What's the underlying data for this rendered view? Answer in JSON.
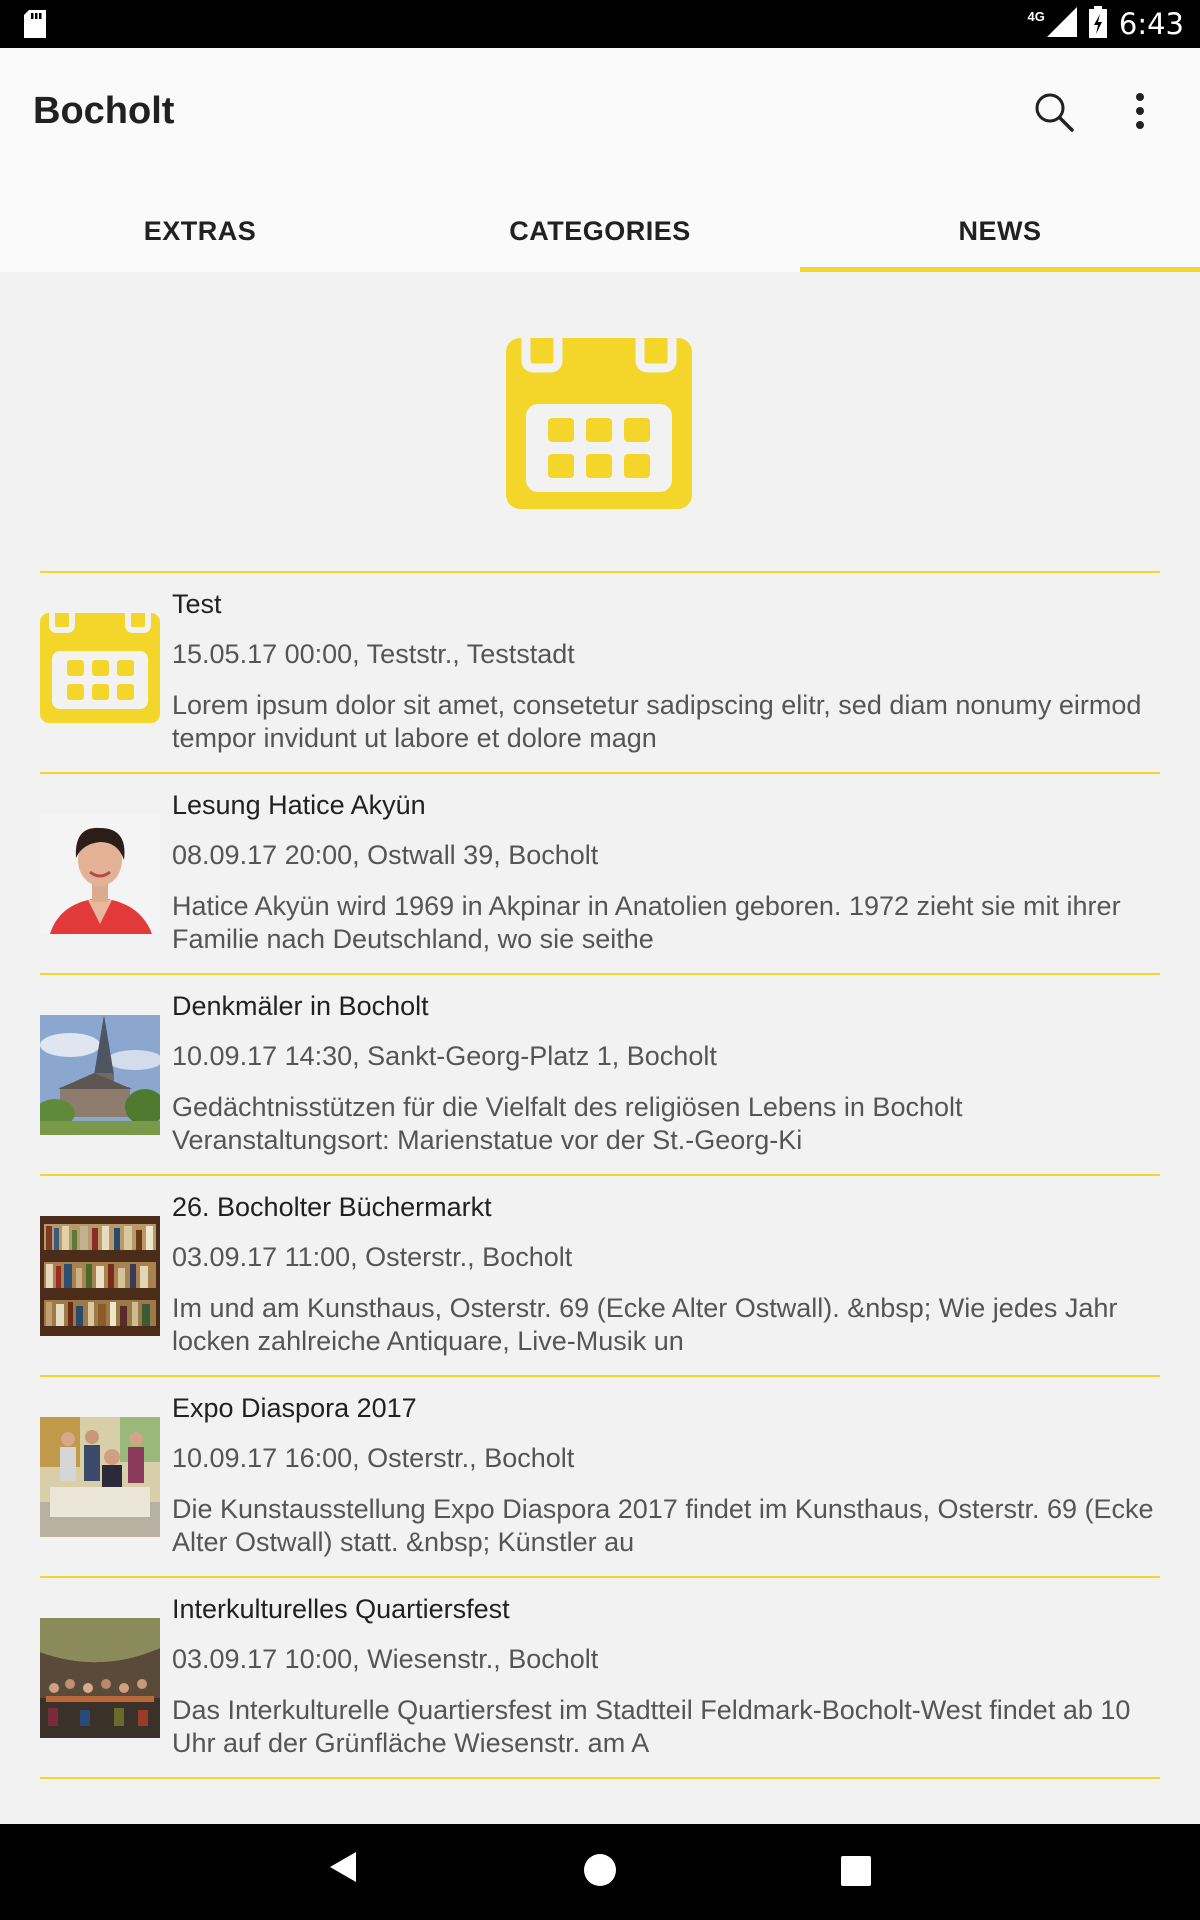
{
  "status_bar": {
    "time": "6:43",
    "network": "4G",
    "icons": [
      "sd-card-icon",
      "signal-icon",
      "battery-charging-icon"
    ]
  },
  "app_bar": {
    "title": "Bocholt",
    "actions": [
      "search-icon",
      "overflow-menu-icon"
    ]
  },
  "tabs": [
    {
      "label": "EXTRAS"
    },
    {
      "label": "CATEGORIES"
    },
    {
      "label": "NEWS"
    }
  ],
  "active_tab": "NEWS",
  "accent_color": "#f4d62a",
  "hero_icon": "calendar-icon",
  "events": [
    {
      "title": "Test",
      "meta": "15.05.17 00:00, Teststr., Teststadt",
      "desc": "Lorem ipsum dolor sit amet, consetetur sadipscing elitr, sed diam nonumy eirmod tempor invidunt ut labore et dolore magn",
      "thumb": "calendar-icon"
    },
    {
      "title": "Lesung Hatice Akyün",
      "meta": "08.09.17 20:00, Ostwall 39, Bocholt",
      "desc": "Hatice Akyün wird 1969 in Akpinar in Anatolien geboren. 1972 zieht sie mit ihrer Familie nach Deutschland, wo sie seithe",
      "thumb": "portrait-photo"
    },
    {
      "title": "Denkmäler in Bocholt",
      "meta": "10.09.17 14:30, Sankt-Georg-Platz 1, Bocholt",
      "desc": "Gedächtnisstützen für die Vielfalt des religiösen Lebens in Bocholt Veranstaltungsort: Marienstatue vor der St.-Georg-Ki",
      "thumb": "church-photo"
    },
    {
      "title": "26. Bocholter Büchermarkt",
      "meta": "03.09.17 11:00, Osterstr., Bocholt",
      "desc": "Im und am Kunsthaus, Osterstr. 69 (Ecke Alter Ostwall). &nbsp; Wie jedes Jahr locken zahlreiche Antiquare, Live-Musik un",
      "thumb": "bookshelf-photo"
    },
    {
      "title": "Expo Diaspora 2017",
      "meta": "10.09.17 16:00, Osterstr., Bocholt",
      "desc": "Die Kunstausstellung Expo Diaspora 2017 findet im Kunsthaus, Osterstr. 69 (Ecke Alter Ostwall) statt. &nbsp; Künstler au",
      "thumb": "group-photo"
    },
    {
      "title": "Interkulturelles Quartiersfest",
      "meta": "03.09.17 10:00, Wiesenstr., Bocholt",
      "desc": "Das Interkulturelle Quartiersfest im Stadtteil Feldmark-Bocholt-West findet ab 10 Uhr auf der Grünfläche Wiesenstr. am A",
      "thumb": "festival-tent-photo"
    }
  ],
  "nav_bar": [
    "back-icon",
    "home-icon",
    "recents-icon"
  ]
}
